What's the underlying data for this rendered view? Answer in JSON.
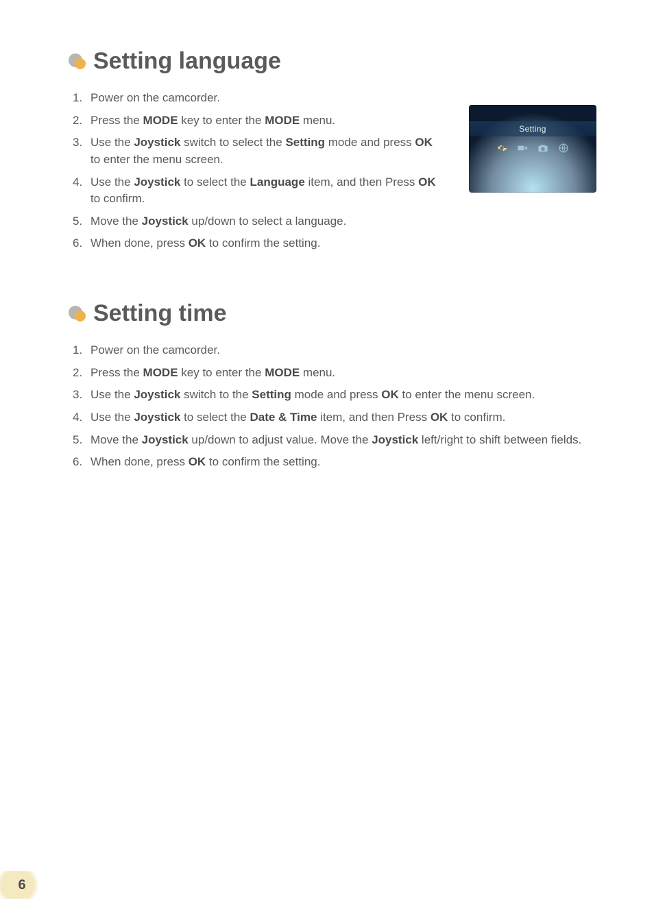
{
  "page_number": "6",
  "sections": [
    {
      "title": "Setting language",
      "narrow": true,
      "steps": [
        [
          {
            "t": "Power on the camcorder."
          }
        ],
        [
          {
            "t": "Press the "
          },
          {
            "b": "MODE"
          },
          {
            "t": " key to enter the "
          },
          {
            "b": "MODE"
          },
          {
            "t": " menu."
          }
        ],
        [
          {
            "t": "Use the "
          },
          {
            "b": "Joystick"
          },
          {
            "t": " switch to select the "
          },
          {
            "b": "Setting"
          },
          {
            "t": " mode and press "
          },
          {
            "b": "OK"
          },
          {
            "t": " to enter the menu screen."
          }
        ],
        [
          {
            "t": "Use the "
          },
          {
            "b": "Joystick"
          },
          {
            "t": " to select the "
          },
          {
            "b": "Language"
          },
          {
            "t": " item, and then Press "
          },
          {
            "b": "OK"
          },
          {
            "t": " to confirm."
          }
        ],
        [
          {
            "t": "Move the "
          },
          {
            "b": "Joystick"
          },
          {
            "t": " up/down to select a language."
          }
        ],
        [
          {
            "t": "When done, press "
          },
          {
            "b": "OK"
          },
          {
            "t": " to confirm the setting."
          }
        ]
      ]
    },
    {
      "title": "Setting time",
      "narrow": false,
      "steps": [
        [
          {
            "t": "Power on the camcorder."
          }
        ],
        [
          {
            "t": "Press the "
          },
          {
            "b": "MODE"
          },
          {
            "t": " key to enter the "
          },
          {
            "b": "MODE"
          },
          {
            "t": " menu."
          }
        ],
        [
          {
            "t": "Use the "
          },
          {
            "b": "Joystick"
          },
          {
            "t": " switch to the "
          },
          {
            "b": "Setting"
          },
          {
            "t": " mode and press "
          },
          {
            "b": "OK"
          },
          {
            "t": " to enter the menu screen."
          }
        ],
        [
          {
            "t": "Use the "
          },
          {
            "b": "Joystick"
          },
          {
            "t": " to select the "
          },
          {
            "b": "Date & Time"
          },
          {
            "t": " item, and then Press "
          },
          {
            "b": "OK"
          },
          {
            "t": " to confirm."
          }
        ],
        [
          {
            "t": "Move the "
          },
          {
            "b": "Joystick"
          },
          {
            "t": " up/down to adjust value. Move the "
          },
          {
            "b": "Joystick"
          },
          {
            "t": " left/right to shift between fields."
          }
        ],
        [
          {
            "t": "When done, press "
          },
          {
            "b": "OK"
          },
          {
            "t": " to confirm the setting."
          }
        ]
      ]
    }
  ],
  "screenshot": {
    "title": "Setting",
    "icons": [
      "gear",
      "video",
      "photo",
      "globe"
    ],
    "selected_index": 0
  }
}
